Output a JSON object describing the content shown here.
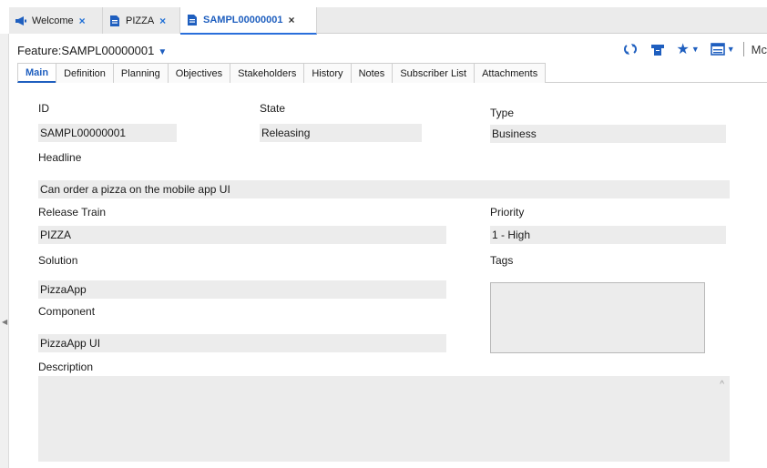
{
  "doc_tabs": [
    {
      "label": "Welcome",
      "icon": "megaphone-icon",
      "active": false
    },
    {
      "label": "PIZZA",
      "icon": "document-icon",
      "active": false
    },
    {
      "label": "SAMPL00000001",
      "icon": "document-icon",
      "active": true
    }
  ],
  "close_glyph": "×",
  "feature_title": "Feature:SAMPL00000001",
  "toolbar": {
    "more_label": "Mc"
  },
  "subtabs": [
    "Main",
    "Definition",
    "Planning",
    "Objectives",
    "Stakeholders",
    "History",
    "Notes",
    "Subscriber List",
    "Attachments"
  ],
  "form": {
    "id_label": "ID",
    "id_value": "SAMPL00000001",
    "state_label": "State",
    "state_value": "Releasing",
    "type_label": "Type",
    "type_value": "Business",
    "headline_label": "Headline",
    "headline_value": "Can order a pizza on the mobile app UI",
    "release_train_label": "Release Train",
    "release_train_value": "PIZZA",
    "priority_label": "Priority",
    "priority_value": "1 - High",
    "solution_label": "Solution",
    "solution_value": "PizzaApp",
    "tags_label": "Tags",
    "component_label": "Component",
    "component_value": "PizzaApp UI",
    "description_label": "Description",
    "description_value": ""
  },
  "colors": {
    "accent": "#1f5fbf",
    "field_bg": "#ececec"
  }
}
